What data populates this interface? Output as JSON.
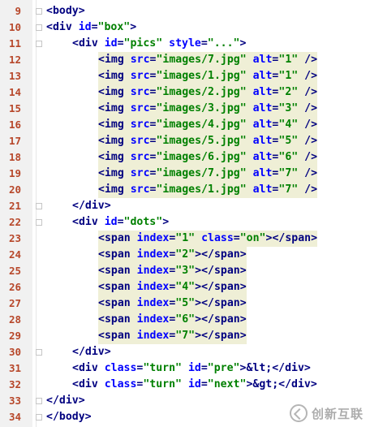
{
  "editor": {
    "lines": [
      {
        "num": "9",
        "indent": 0,
        "tokens": [
          {
            "t": "<body>",
            "c": "tag"
          }
        ]
      },
      {
        "num": "10",
        "indent": 0,
        "tokens": [
          {
            "t": "<div ",
            "c": "tag"
          },
          {
            "t": "id",
            "c": "attr"
          },
          {
            "t": "=",
            "c": "tag"
          },
          {
            "t": "\"box\"",
            "c": "str"
          },
          {
            "t": ">",
            "c": "tag"
          }
        ]
      },
      {
        "num": "11",
        "indent": 1,
        "tokens": [
          {
            "t": "<div ",
            "c": "tag"
          },
          {
            "t": "id",
            "c": "attr"
          },
          {
            "t": "=",
            "c": "tag"
          },
          {
            "t": "\"pics\"",
            "c": "str"
          },
          {
            "t": " ",
            "c": "tag"
          },
          {
            "t": "style",
            "c": "attr"
          },
          {
            "t": "=",
            "c": "tag"
          },
          {
            "t": "\"...\"",
            "c": "str"
          },
          {
            "t": ">",
            "c": "tag"
          }
        ]
      },
      {
        "num": "12",
        "indent": 2,
        "hl": true,
        "tokens": [
          {
            "t": "<img ",
            "c": "tag"
          },
          {
            "t": "src",
            "c": "attr"
          },
          {
            "t": "=",
            "c": "tag"
          },
          {
            "t": "\"images/7.jpg\"",
            "c": "str"
          },
          {
            "t": " ",
            "c": "tag"
          },
          {
            "t": "alt",
            "c": "attr"
          },
          {
            "t": "=",
            "c": "tag"
          },
          {
            "t": "\"1\"",
            "c": "str"
          },
          {
            "t": " />",
            "c": "tag"
          }
        ]
      },
      {
        "num": "13",
        "indent": 2,
        "hl": true,
        "tokens": [
          {
            "t": "<img ",
            "c": "tag"
          },
          {
            "t": "src",
            "c": "attr"
          },
          {
            "t": "=",
            "c": "tag"
          },
          {
            "t": "\"images/1.jpg\"",
            "c": "str"
          },
          {
            "t": " ",
            "c": "tag"
          },
          {
            "t": "alt",
            "c": "attr"
          },
          {
            "t": "=",
            "c": "tag"
          },
          {
            "t": "\"1\"",
            "c": "str"
          },
          {
            "t": " />",
            "c": "tag"
          }
        ]
      },
      {
        "num": "14",
        "indent": 2,
        "hl": true,
        "tokens": [
          {
            "t": "<img ",
            "c": "tag"
          },
          {
            "t": "src",
            "c": "attr"
          },
          {
            "t": "=",
            "c": "tag"
          },
          {
            "t": "\"images/2.jpg\"",
            "c": "str"
          },
          {
            "t": " ",
            "c": "tag"
          },
          {
            "t": "alt",
            "c": "attr"
          },
          {
            "t": "=",
            "c": "tag"
          },
          {
            "t": "\"2\"",
            "c": "str"
          },
          {
            "t": " />",
            "c": "tag"
          }
        ]
      },
      {
        "num": "15",
        "indent": 2,
        "hl": true,
        "tokens": [
          {
            "t": "<img ",
            "c": "tag"
          },
          {
            "t": "src",
            "c": "attr"
          },
          {
            "t": "=",
            "c": "tag"
          },
          {
            "t": "\"images/3.jpg\"",
            "c": "str"
          },
          {
            "t": " ",
            "c": "tag"
          },
          {
            "t": "alt",
            "c": "attr"
          },
          {
            "t": "=",
            "c": "tag"
          },
          {
            "t": "\"3\"",
            "c": "str"
          },
          {
            "t": " />",
            "c": "tag"
          }
        ]
      },
      {
        "num": "16",
        "indent": 2,
        "hl": true,
        "tokens": [
          {
            "t": "<img ",
            "c": "tag"
          },
          {
            "t": "src",
            "c": "attr"
          },
          {
            "t": "=",
            "c": "tag"
          },
          {
            "t": "\"images/4.jpg\"",
            "c": "str"
          },
          {
            "t": " ",
            "c": "tag"
          },
          {
            "t": "alt",
            "c": "attr"
          },
          {
            "t": "=",
            "c": "tag"
          },
          {
            "t": "\"4\"",
            "c": "str"
          },
          {
            "t": " />",
            "c": "tag"
          }
        ]
      },
      {
        "num": "17",
        "indent": 2,
        "hl": true,
        "tokens": [
          {
            "t": "<img ",
            "c": "tag"
          },
          {
            "t": "src",
            "c": "attr"
          },
          {
            "t": "=",
            "c": "tag"
          },
          {
            "t": "\"images/5.jpg\"",
            "c": "str"
          },
          {
            "t": " ",
            "c": "tag"
          },
          {
            "t": "alt",
            "c": "attr"
          },
          {
            "t": "=",
            "c": "tag"
          },
          {
            "t": "\"5\"",
            "c": "str"
          },
          {
            "t": " />",
            "c": "tag"
          }
        ]
      },
      {
        "num": "18",
        "indent": 2,
        "hl": true,
        "tokens": [
          {
            "t": "<img ",
            "c": "tag"
          },
          {
            "t": "src",
            "c": "attr"
          },
          {
            "t": "=",
            "c": "tag"
          },
          {
            "t": "\"images/6.jpg\"",
            "c": "str"
          },
          {
            "t": " ",
            "c": "tag"
          },
          {
            "t": "alt",
            "c": "attr"
          },
          {
            "t": "=",
            "c": "tag"
          },
          {
            "t": "\"6\"",
            "c": "str"
          },
          {
            "t": " />",
            "c": "tag"
          }
        ]
      },
      {
        "num": "19",
        "indent": 2,
        "hl": true,
        "tokens": [
          {
            "t": "<img ",
            "c": "tag"
          },
          {
            "t": "src",
            "c": "attr"
          },
          {
            "t": "=",
            "c": "tag"
          },
          {
            "t": "\"images/7.jpg\"",
            "c": "str"
          },
          {
            "t": " ",
            "c": "tag"
          },
          {
            "t": "alt",
            "c": "attr"
          },
          {
            "t": "=",
            "c": "tag"
          },
          {
            "t": "\"7\"",
            "c": "str"
          },
          {
            "t": " />",
            "c": "tag"
          }
        ]
      },
      {
        "num": "20",
        "indent": 2,
        "hl": true,
        "tokens": [
          {
            "t": "<img ",
            "c": "tag"
          },
          {
            "t": "src",
            "c": "attr"
          },
          {
            "t": "=",
            "c": "tag"
          },
          {
            "t": "\"images/1.jpg\"",
            "c": "str"
          },
          {
            "t": " ",
            "c": "tag"
          },
          {
            "t": "alt",
            "c": "attr"
          },
          {
            "t": "=",
            "c": "tag"
          },
          {
            "t": "\"7\"",
            "c": "str"
          },
          {
            "t": " />",
            "c": "tag"
          }
        ]
      },
      {
        "num": "21",
        "indent": 1,
        "tokens": [
          {
            "t": "</div>",
            "c": "tag"
          }
        ]
      },
      {
        "num": "22",
        "indent": 1,
        "tokens": [
          {
            "t": "<div ",
            "c": "tag"
          },
          {
            "t": "id",
            "c": "attr"
          },
          {
            "t": "=",
            "c": "tag"
          },
          {
            "t": "\"dots\"",
            "c": "str"
          },
          {
            "t": ">",
            "c": "tag"
          }
        ]
      },
      {
        "num": "23",
        "indent": 2,
        "hl": true,
        "tokens": [
          {
            "t": "<span ",
            "c": "tag"
          },
          {
            "t": "index",
            "c": "attr"
          },
          {
            "t": "=",
            "c": "tag"
          },
          {
            "t": "\"1\"",
            "c": "str"
          },
          {
            "t": " ",
            "c": "tag"
          },
          {
            "t": "class",
            "c": "attr"
          },
          {
            "t": "=",
            "c": "tag"
          },
          {
            "t": "\"on\"",
            "c": "str"
          },
          {
            "t": "></span>",
            "c": "tag"
          }
        ]
      },
      {
        "num": "24",
        "indent": 2,
        "hl": true,
        "tokens": [
          {
            "t": "<span ",
            "c": "tag"
          },
          {
            "t": "index",
            "c": "attr"
          },
          {
            "t": "=",
            "c": "tag"
          },
          {
            "t": "\"2\"",
            "c": "str"
          },
          {
            "t": "></span>",
            "c": "tag"
          }
        ]
      },
      {
        "num": "25",
        "indent": 2,
        "hl": true,
        "tokens": [
          {
            "t": "<span ",
            "c": "tag"
          },
          {
            "t": "index",
            "c": "attr"
          },
          {
            "t": "=",
            "c": "tag"
          },
          {
            "t": "\"3\"",
            "c": "str"
          },
          {
            "t": "></span>",
            "c": "tag"
          }
        ]
      },
      {
        "num": "26",
        "indent": 2,
        "hl": true,
        "tokens": [
          {
            "t": "<span ",
            "c": "tag"
          },
          {
            "t": "index",
            "c": "attr"
          },
          {
            "t": "=",
            "c": "tag"
          },
          {
            "t": "\"4\"",
            "c": "str"
          },
          {
            "t": "></span>",
            "c": "tag"
          }
        ]
      },
      {
        "num": "27",
        "indent": 2,
        "hl": true,
        "tokens": [
          {
            "t": "<span ",
            "c": "tag"
          },
          {
            "t": "index",
            "c": "attr"
          },
          {
            "t": "=",
            "c": "tag"
          },
          {
            "t": "\"5\"",
            "c": "str"
          },
          {
            "t": "></span>",
            "c": "tag"
          }
        ]
      },
      {
        "num": "28",
        "indent": 2,
        "hl": true,
        "tokens": [
          {
            "t": "<span ",
            "c": "tag"
          },
          {
            "t": "index",
            "c": "attr"
          },
          {
            "t": "=",
            "c": "tag"
          },
          {
            "t": "\"6\"",
            "c": "str"
          },
          {
            "t": "></span>",
            "c": "tag"
          }
        ]
      },
      {
        "num": "29",
        "indent": 2,
        "hl": true,
        "tokens": [
          {
            "t": "<span ",
            "c": "tag"
          },
          {
            "t": "index",
            "c": "attr"
          },
          {
            "t": "=",
            "c": "tag"
          },
          {
            "t": "\"7\"",
            "c": "str"
          },
          {
            "t": "></span>",
            "c": "tag"
          }
        ]
      },
      {
        "num": "30",
        "indent": 1,
        "tokens": [
          {
            "t": "</div>",
            "c": "tag"
          }
        ]
      },
      {
        "num": "31",
        "indent": 1,
        "tokens": [
          {
            "t": "<div ",
            "c": "tag"
          },
          {
            "t": "class",
            "c": "attr"
          },
          {
            "t": "=",
            "c": "tag"
          },
          {
            "t": "\"turn\"",
            "c": "str"
          },
          {
            "t": " ",
            "c": "tag"
          },
          {
            "t": "id",
            "c": "attr"
          },
          {
            "t": "=",
            "c": "tag"
          },
          {
            "t": "\"pre\"",
            "c": "str"
          },
          {
            "t": ">",
            "c": "tag"
          },
          {
            "t": "&lt;",
            "c": "ent"
          },
          {
            "t": "</div>",
            "c": "tag"
          }
        ]
      },
      {
        "num": "32",
        "indent": 1,
        "tokens": [
          {
            "t": "<div ",
            "c": "tag"
          },
          {
            "t": "class",
            "c": "attr"
          },
          {
            "t": "=",
            "c": "tag"
          },
          {
            "t": "\"turn\"",
            "c": "str"
          },
          {
            "t": " ",
            "c": "tag"
          },
          {
            "t": "id",
            "c": "attr"
          },
          {
            "t": "=",
            "c": "tag"
          },
          {
            "t": "\"next\"",
            "c": "str"
          },
          {
            "t": ">",
            "c": "tag"
          },
          {
            "t": "&gt;",
            "c": "ent"
          },
          {
            "t": "</div>",
            "c": "tag"
          }
        ]
      },
      {
        "num": "33",
        "indent": 0,
        "tokens": [
          {
            "t": "</div>",
            "c": "tag"
          }
        ]
      },
      {
        "num": "34",
        "indent": 0,
        "tokens": [
          {
            "t": "</body>",
            "c": "tag"
          }
        ]
      }
    ],
    "fold_markers_on": [
      "9",
      "10",
      "11",
      "21",
      "22",
      "30",
      "33",
      "34"
    ]
  },
  "watermark": {
    "icon": "brand-logo-icon",
    "text": "创新互联"
  },
  "colors": {
    "tag": "#000080",
    "attribute": "#0000ff",
    "string": "#008000",
    "line_number": "#b7472a",
    "highlight": "#efefd6"
  }
}
